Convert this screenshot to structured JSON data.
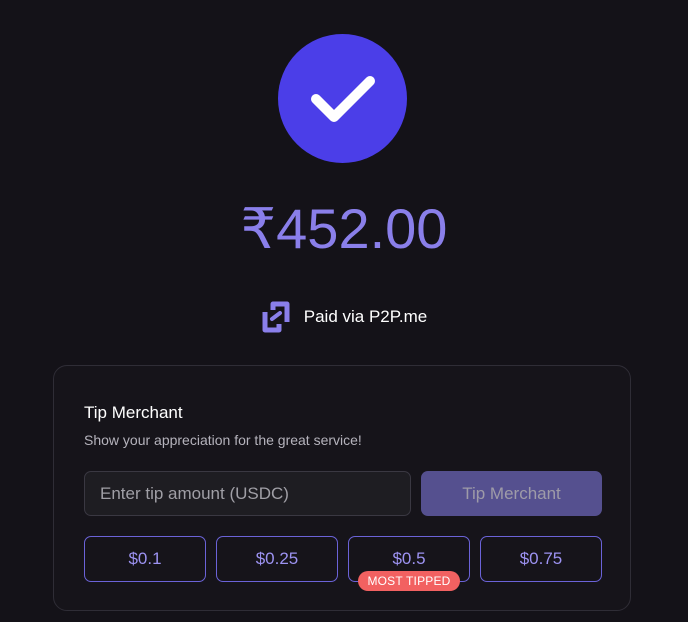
{
  "payment": {
    "amount": "₹452.00",
    "paid_via": "Paid via P2P.me"
  },
  "tip": {
    "title": "Tip Merchant",
    "subtitle": "Show your appreciation for the great service!",
    "input_placeholder": "Enter tip amount (USDC)",
    "button_label": "Tip Merchant",
    "presets": [
      "$0.1",
      "$0.25",
      "$0.5",
      "$0.75"
    ],
    "most_tipped_badge": "MOST TIPPED"
  },
  "icons": {
    "success": "checkmark-icon",
    "brand": "p2p-logo-icon"
  },
  "colors": {
    "background": "#141218",
    "accent": "#4b3ee8",
    "amount_text": "#8a7fea",
    "badge": "#f26161"
  }
}
